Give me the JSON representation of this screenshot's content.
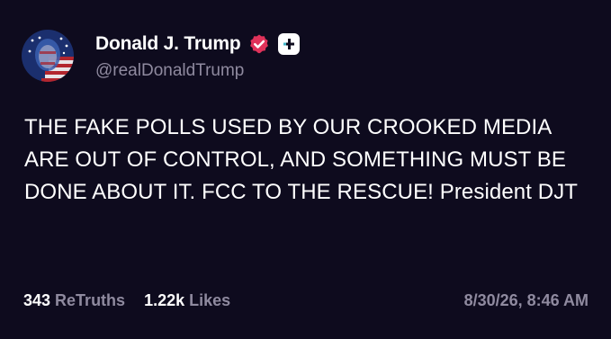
{
  "post": {
    "author": {
      "display_name": "Donald J. Trump",
      "handle": "@realDonaldTrump",
      "verified_icon": "verified-check-badge",
      "badge_icon": "plus-badge",
      "avatar": "flag-painted-portrait"
    },
    "text": "THE FAKE POLLS USED BY OUR CROOKED MEDIA ARE OUT OF CONTROL, AND SOMETHING MUST BE DONE ABOUT IT. FCC TO THE RESCUE! President DJT",
    "stats": {
      "retruths_count": "343",
      "retruths_label": "ReTruths",
      "likes_count": "1.22k",
      "likes_label": "Likes"
    },
    "timestamp": "8/30/26, 8:46 AM"
  },
  "colors": {
    "background": "#0e0b1e",
    "text": "#ffffff",
    "muted": "#8f8a9f",
    "verified": "#e0325a"
  }
}
